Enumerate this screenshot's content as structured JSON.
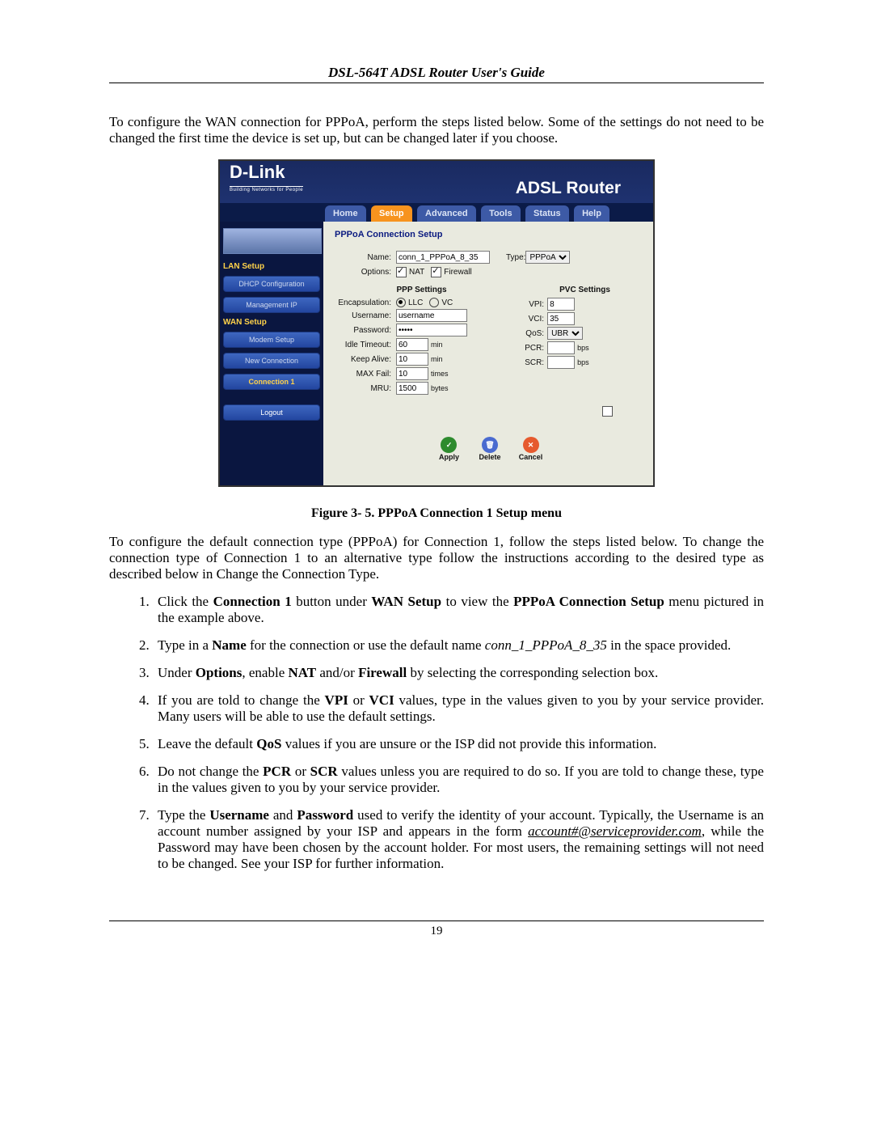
{
  "doc": {
    "header": "DSL-564T ADSL Router User's Guide",
    "intro": "To configure the WAN connection for PPPoA, perform the steps listed below. Some of the settings do not need to be changed the first time the device is set up, but can be changed later if you choose.",
    "caption": "Figure 3- 5. PPPoA Connection 1 Setup menu",
    "para2": "To configure the default connection type (PPPoA) for Connection 1, follow the steps listed below. To change the connection type of Connection 1 to an alternative type follow the instructions according to the desired type as described below in Change the Connection Type.",
    "page_num": "19"
  },
  "steps": {
    "s1a": "Click the ",
    "s1b": "Connection 1",
    "s1c": " button under ",
    "s1d": "WAN Setup",
    "s1e": " to view the ",
    "s1f": "PPPoA Connection Setup",
    "s1g": " menu pictured in the example above.",
    "s2a": "Type in a ",
    "s2b": "Name",
    "s2c": " for the connection or use the default name ",
    "s2d": "conn_1_PPPoA_8_35",
    "s2e": " in the space provided.",
    "s3a": "Under ",
    "s3b": "Options",
    "s3c": ", enable ",
    "s3d": "NAT",
    "s3e": " and/or ",
    "s3f": "Firewall",
    "s3g": " by selecting the corresponding selection box.",
    "s4a": "If you are told to change the ",
    "s4b": "VPI",
    "s4c": " or ",
    "s4d": "VCI",
    "s4e": " values, type in the values given to you by your service provider. Many users will be able to use the default settings.",
    "s5a": "Leave the default ",
    "s5b": "QoS",
    "s5c": " values if you are unsure or the ISP did not provide this information.",
    "s6a": "Do not change the ",
    "s6b": "PCR",
    "s6c": " or ",
    "s6d": "SCR",
    "s6e": " values unless you are required to do so. If you are told to change these, type in the values given to you by your service provider.",
    "s7a": "Type the ",
    "s7b": "Username",
    "s7c": " and ",
    "s7d": "Password",
    "s7e": " used to verify the identity of your account. Typically, the Username is an account number assigned by your ISP and appears in the form ",
    "s7f": "account#@serviceprovider.com",
    "s7g": ", while the Password may have been chosen by the account holder. For most users, the remaining settings will not need to be changed. See your ISP for further information."
  },
  "router": {
    "logo": "D-Link",
    "logo_sub": "Building Networks for People",
    "title": "ADSL Router",
    "tabs": [
      "Home",
      "Setup",
      "Advanced",
      "Tools",
      "Status",
      "Help"
    ],
    "sidebar": {
      "lan": "LAN Setup",
      "dhcp": "DHCP Configuration",
      "mgmt": "Management IP",
      "wan": "WAN Setup",
      "modem": "Modem Setup",
      "newc": "New Connection",
      "conn1": "Connection 1",
      "logout": "Logout"
    },
    "content": {
      "title": "PPPoA Connection Setup",
      "name_lab": "Name:",
      "name_val": "conn_1_PPPoA_8_35",
      "type_lab": "Type:",
      "type_val": "PPPoA",
      "opt_lab": "Options:",
      "opt_nat": "NAT",
      "opt_fw": "Firewall",
      "ppp_title": "PPP Settings",
      "encap_lab": "Encapsulation:",
      "encap_llc": "LLC",
      "encap_vc": "VC",
      "user_lab": "Username:",
      "user_val": "username",
      "pass_lab": "Password:",
      "pass_val": "•••••",
      "idle_lab": "Idle Timeout:",
      "idle_val": "60",
      "idle_unit": "min",
      "keep_lab": "Keep Alive:",
      "keep_val": "10",
      "keep_unit": "min",
      "max_lab": "MAX Fail:",
      "max_val": "10",
      "max_unit": "times",
      "mru_lab": "MRU:",
      "mru_val": "1500",
      "mru_unit": "bytes",
      "pvc_title": "PVC Settings",
      "vpi_lab": "VPI:",
      "vpi_val": "8",
      "vci_lab": "VCI:",
      "vci_val": "35",
      "qos_lab": "QoS:",
      "qos_val": "UBR",
      "pcr_lab": "PCR:",
      "pcr_val": "",
      "pcr_unit": "bps",
      "scr_lab": "SCR:",
      "scr_val": "",
      "scr_unit": "bps",
      "apply": "Apply",
      "delete": "Delete",
      "cancel": "Cancel"
    }
  }
}
